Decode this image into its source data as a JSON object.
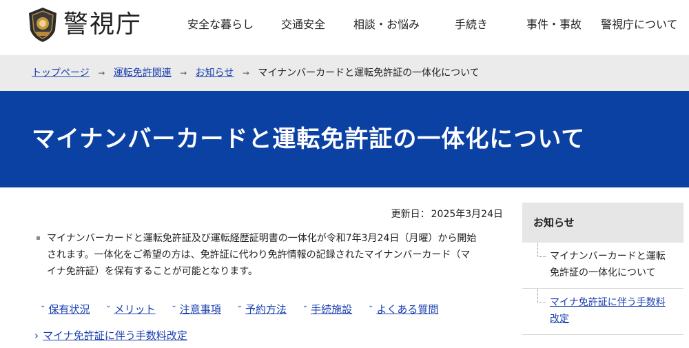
{
  "header": {
    "site_name": "警視庁",
    "nav": [
      "安全な暮らし",
      "交通安全",
      "相談・お悩み",
      "手続き",
      "事件・事故",
      "警視庁について"
    ]
  },
  "breadcrumb": {
    "items": [
      "トップページ",
      "運転免許関連",
      "お知らせ"
    ],
    "current": "マイナンバーカードと運転免許証の一体化について"
  },
  "page": {
    "title": "マイナンバーカードと運転免許証の一体化について",
    "updated_label": "更新日：",
    "updated_date": "2025年3月24日",
    "intro_line1": "マイナンバーカードと運転免許証及び運転経歴証明書の一体化が令和7年3月24日（月曜）から開始",
    "intro_line2": "されます。一体化をご希望の方は、免許証に代わり免許情報の記録されたマイナンバーカード（マ",
    "intro_line3": "イナ免許証）を保有することが可能となります。",
    "anchors": [
      "保有状況",
      "メリット",
      "注意事項",
      "予約方法",
      "手続施設",
      "よくある質問"
    ],
    "related_link": "マイナ免許証に伴う手数料改定"
  },
  "sidebar": {
    "title": "お知らせ",
    "items": [
      {
        "line1": "マイナンバーカードと運転",
        "line2": "免許証の一体化について"
      },
      {
        "line1": "マイナ免許証に伴う手数料",
        "line2": "改定"
      }
    ]
  },
  "colors": {
    "banner": "#0c41a4",
    "link": "#1a3fb0",
    "breadcrumb_bg": "#ebebeb"
  }
}
